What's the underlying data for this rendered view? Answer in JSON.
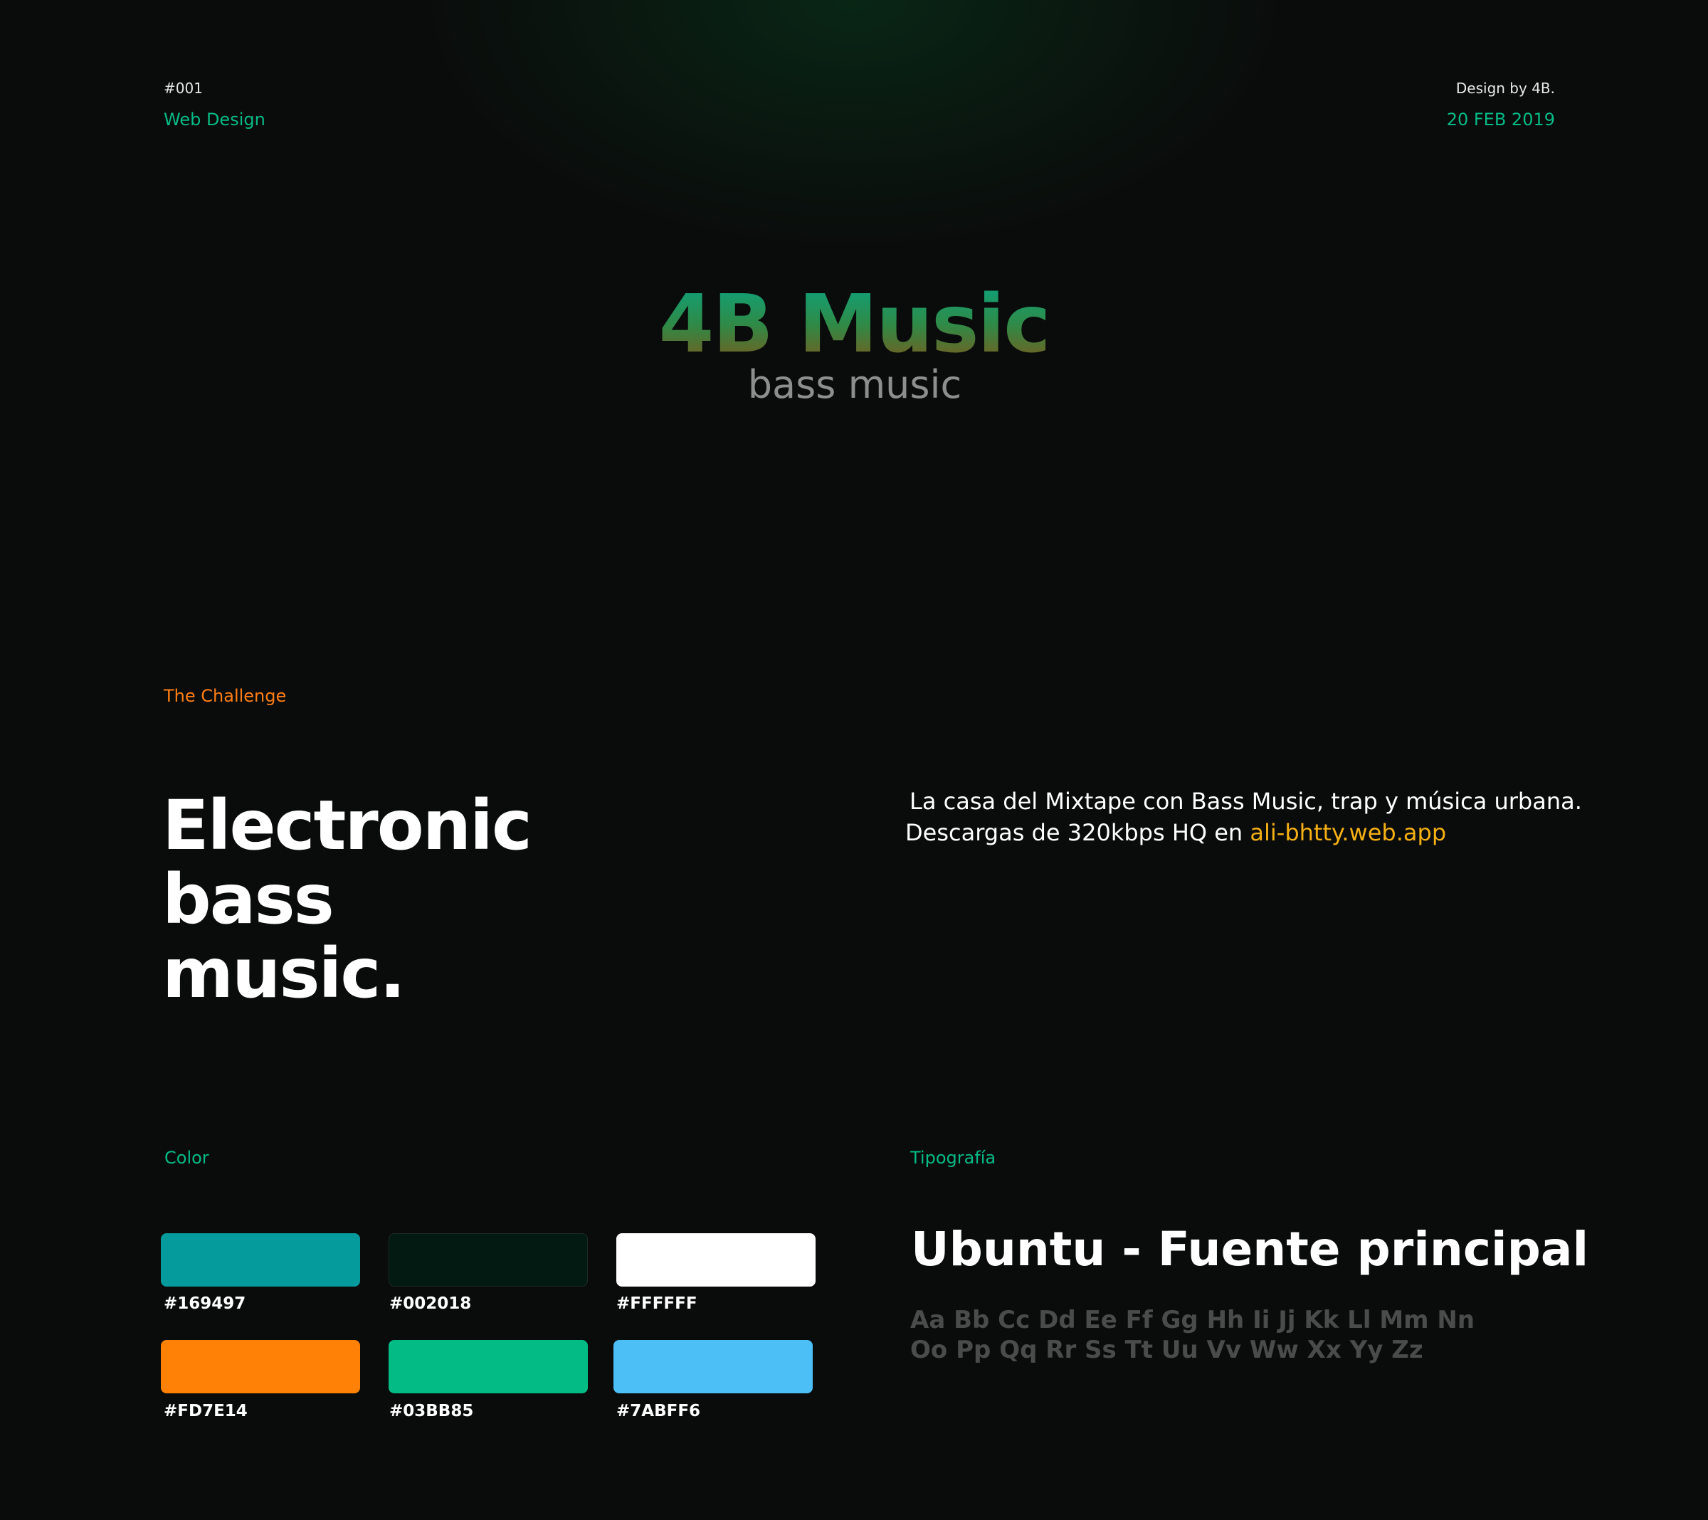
{
  "header": {
    "id": "#001",
    "category": "Web Design",
    "credit": "Design by 4B.",
    "date": "20 FEB 2019"
  },
  "logo": {
    "title": "4B Music",
    "subtitle": "bass music"
  },
  "challenge": {
    "label": "The Challenge",
    "headline_line1": "Electronic bass",
    "headline_line2": "music.",
    "description_line1": "La casa del Mixtape con Bass Music, trap y música urbana.",
    "description_line2_prefix": "Descargas de 320kbps HQ en ",
    "description_link": "ali-bhtty.web.app"
  },
  "colors": {
    "label": "Color",
    "swatches": [
      {
        "hex": "#169497",
        "fill": "#059a9b"
      },
      {
        "hex": "#002018",
        "fill": "#021a12"
      },
      {
        "hex": "#FFFFFF",
        "fill": "#ffffff"
      },
      {
        "hex": "#FD7E14",
        "fill": "#ff8206"
      },
      {
        "hex": "#03BB85",
        "fill": "#03bb85"
      },
      {
        "hex": "#7ABFF6",
        "fill": "#4bbff6"
      }
    ]
  },
  "typography": {
    "label": "Tipografía",
    "font_title": "Ubuntu - Fuente principal",
    "alphabet_line1": "Aa Bb Cc Dd Ee Ff Gg Hh Ii Jj Kk Ll Mm Nn",
    "alphabet_line2": "Oo Pp Qq Rr Ss Tt Uu Vv Ww Xx Yy Zz"
  }
}
